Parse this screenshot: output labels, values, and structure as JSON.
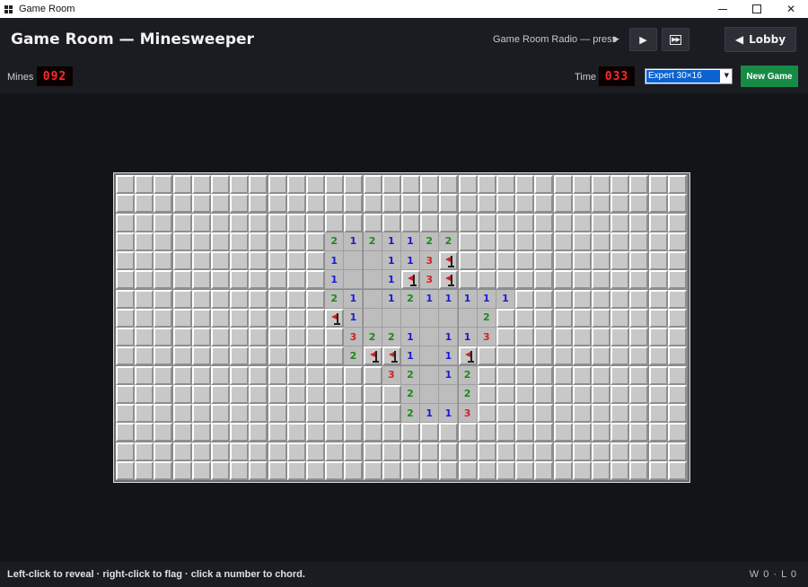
{
  "window": {
    "title": "Game Room"
  },
  "header": {
    "title": "Game Room — Minesweeper",
    "radio_label": "Game Room Radio — press",
    "play_glyph": "▶",
    "lobby_label": "Lobby",
    "lobby_glyph": "◀"
  },
  "toolbar": {
    "mines_label": "Mines",
    "mines_value": "092",
    "time_label": "Time",
    "time_value": "033",
    "difficulty": "Expert 30×16",
    "new_game_label": "New Game"
  },
  "colors": {
    "1": "#1a1ad6",
    "2": "#1a8a1a",
    "3": "#d42020",
    "flag": "#d42020",
    "new_game_bg": "#178a45",
    "lcd_text": "#ff2a2a"
  },
  "icons": [
    "app-icon",
    "play-icon",
    "skip-icon",
    "lobby-back-icon",
    "flag-icon",
    "dropdown-arrow-icon"
  ],
  "board": {
    "cols": 30,
    "rows": 16,
    "grid": [
      "##############################",
      "##############################",
      "##############################",
      "###########2121122############",
      "###########1..113F############",
      "###########1..1F3F############",
      "###########21.1211111#########",
      "###########F1......2#########",
      "############3221.113#########",
      "############2FF1.1F###########",
      "##############32.12###########",
      "###############2..2###########",
      "###############2113###########",
      "##############################",
      "##############################",
      "##############################"
    ]
  },
  "footer": {
    "hint": "Left-click to reveal · right-click to flag · click a number to chord.",
    "score": "W 0 · L 0"
  }
}
